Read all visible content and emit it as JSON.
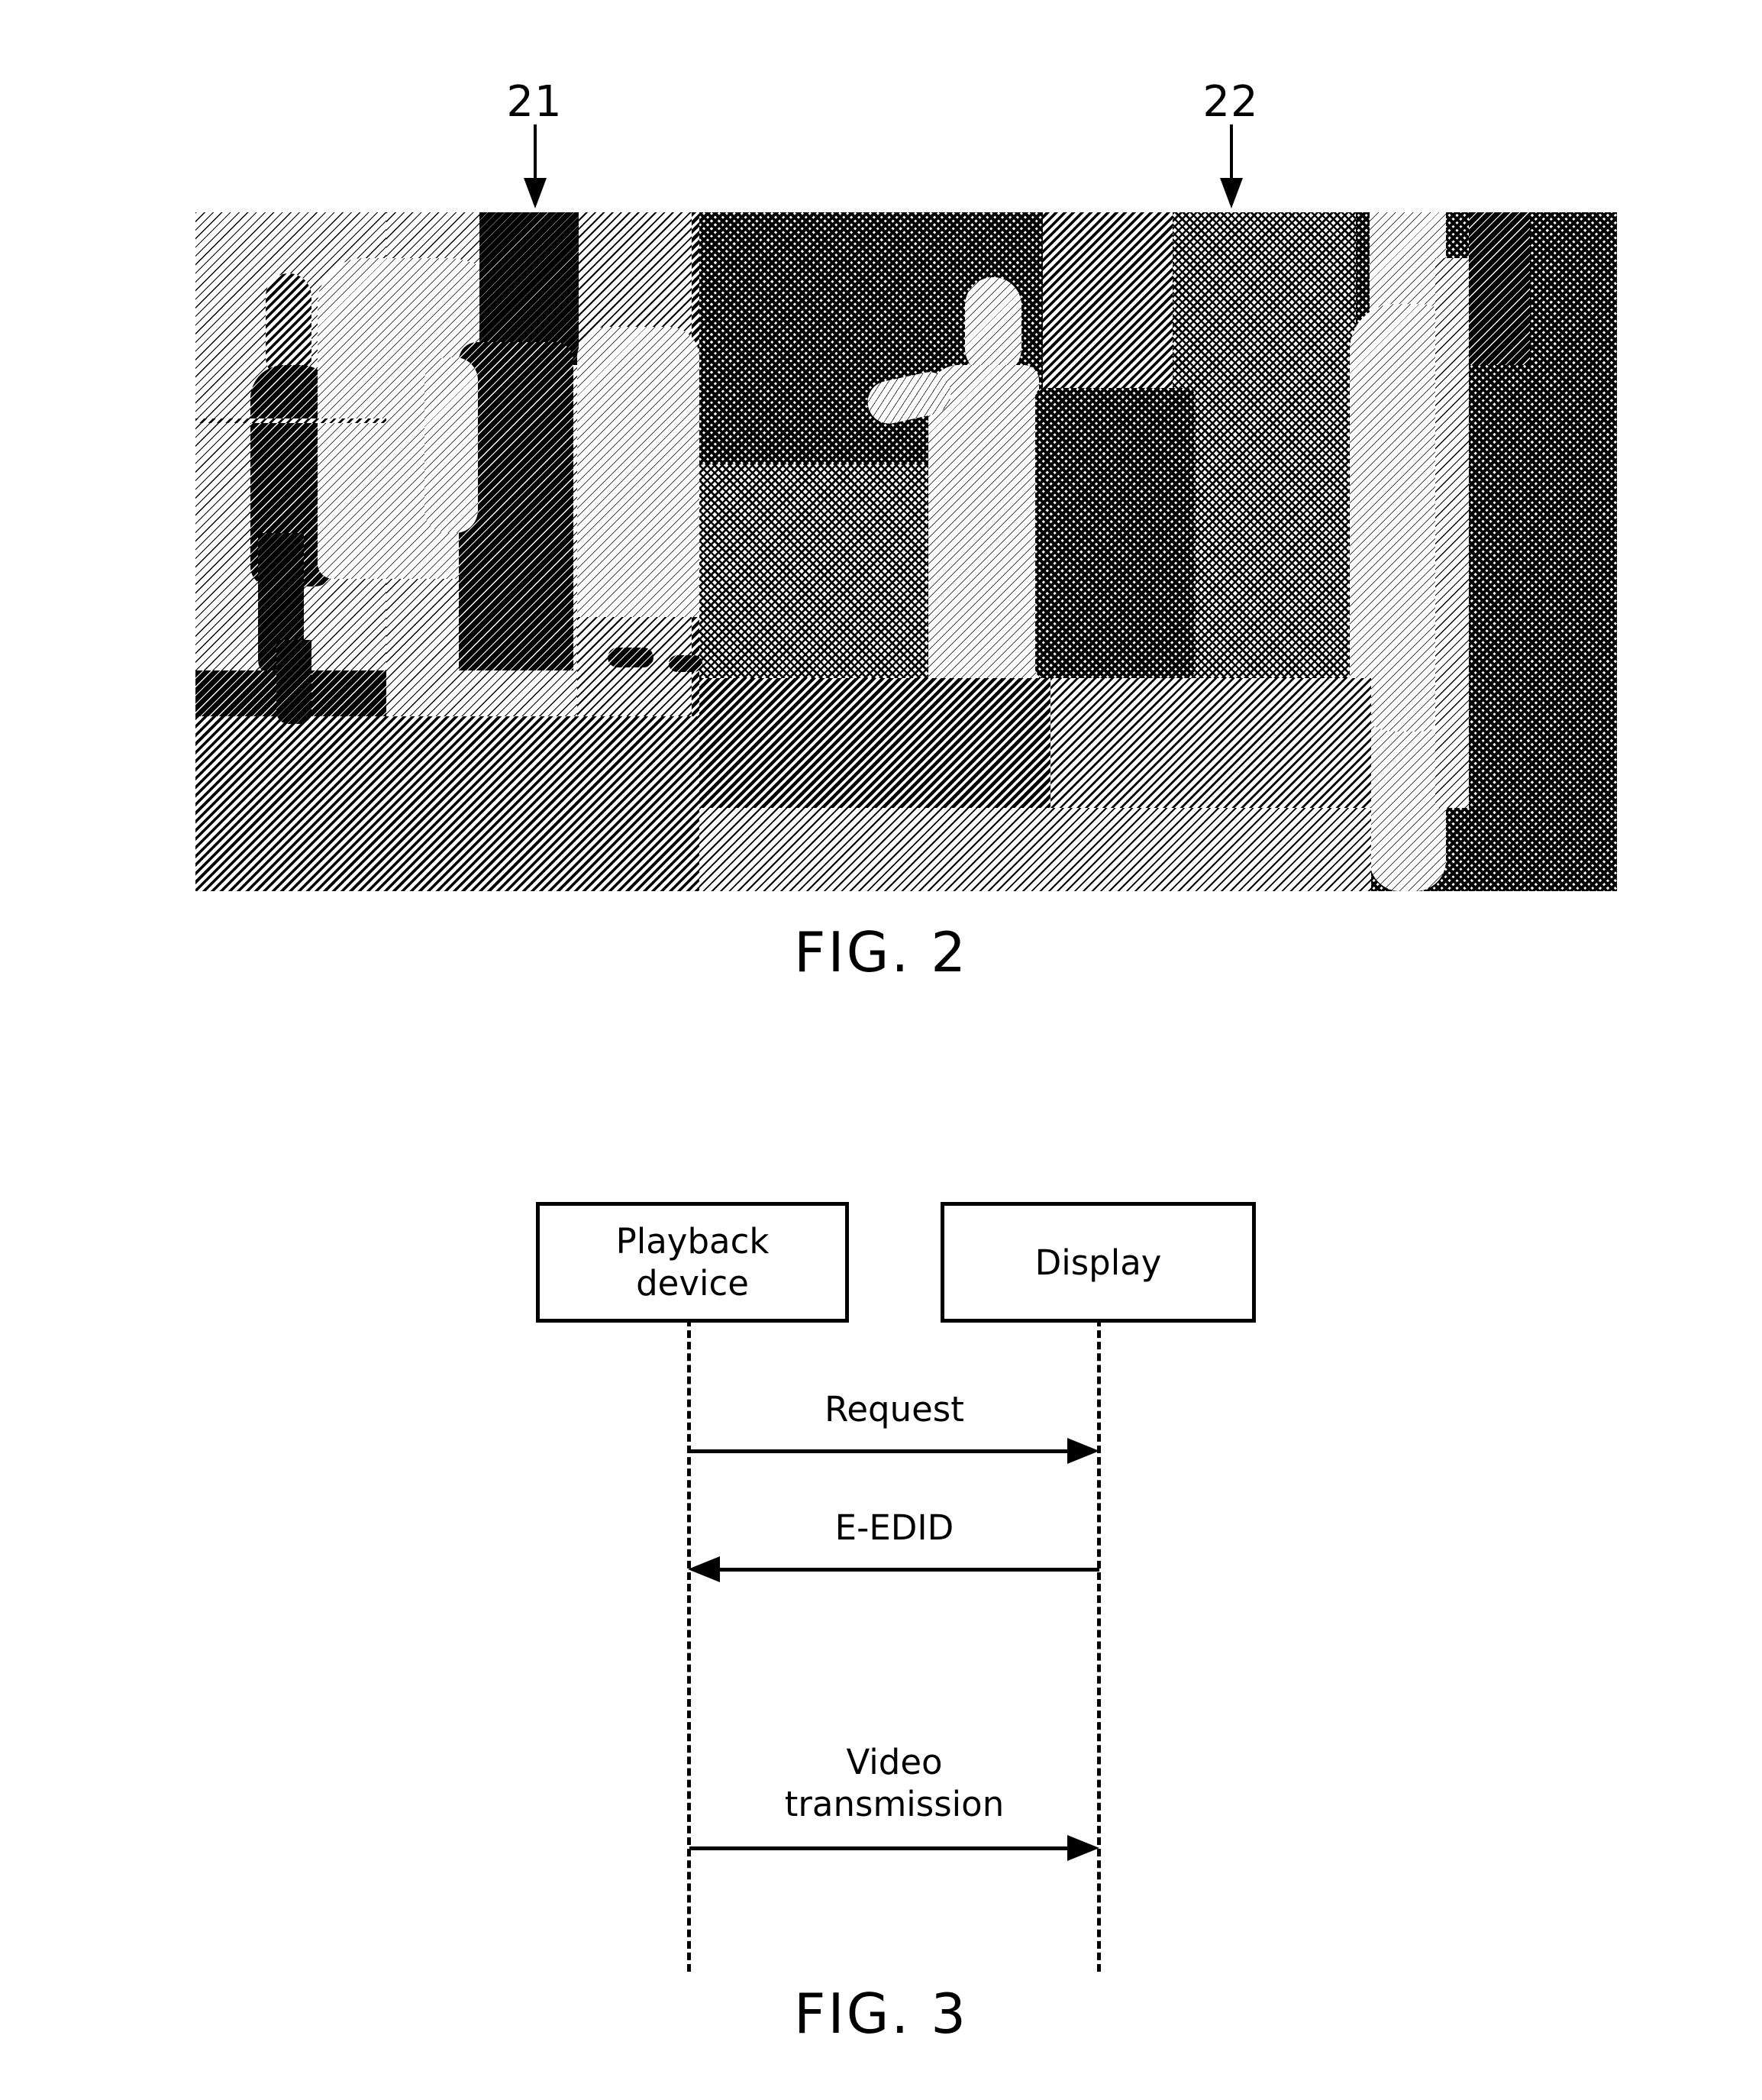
{
  "figures": [
    {
      "id": "fig2",
      "caption": "FIG. 2",
      "type": "photograph",
      "description": "Halftone dithered photograph of a scene with persons",
      "callouts": [
        {
          "label": "21",
          "target": "left region of image"
        },
        {
          "label": "22",
          "target": "right region of image"
        }
      ]
    },
    {
      "id": "fig3",
      "caption": "FIG. 3",
      "type": "sequence-diagram",
      "participants": [
        {
          "id": "playback",
          "label": "Playback\ndevice"
        },
        {
          "id": "display",
          "label": "Display"
        }
      ],
      "messages": [
        {
          "label": "Request",
          "from": "playback",
          "to": "display",
          "direction": "right"
        },
        {
          "label": "E-EDID",
          "from": "display",
          "to": "playback",
          "direction": "left"
        },
        {
          "label": "Video\ntransmission",
          "from": "playback",
          "to": "display",
          "direction": "right"
        }
      ]
    }
  ],
  "fig2": {
    "caption": "FIG. 2",
    "callout_left": "21",
    "callout_right": "22"
  },
  "fig3": {
    "caption": "FIG. 3",
    "box_playback": "Playback\ndevice",
    "box_display": "Display",
    "msg_request": "Request",
    "msg_eedid": "E-EDID",
    "msg_video": "Video\ntransmission"
  },
  "colors": {
    "ink": "#000000",
    "paper": "#ffffff"
  }
}
